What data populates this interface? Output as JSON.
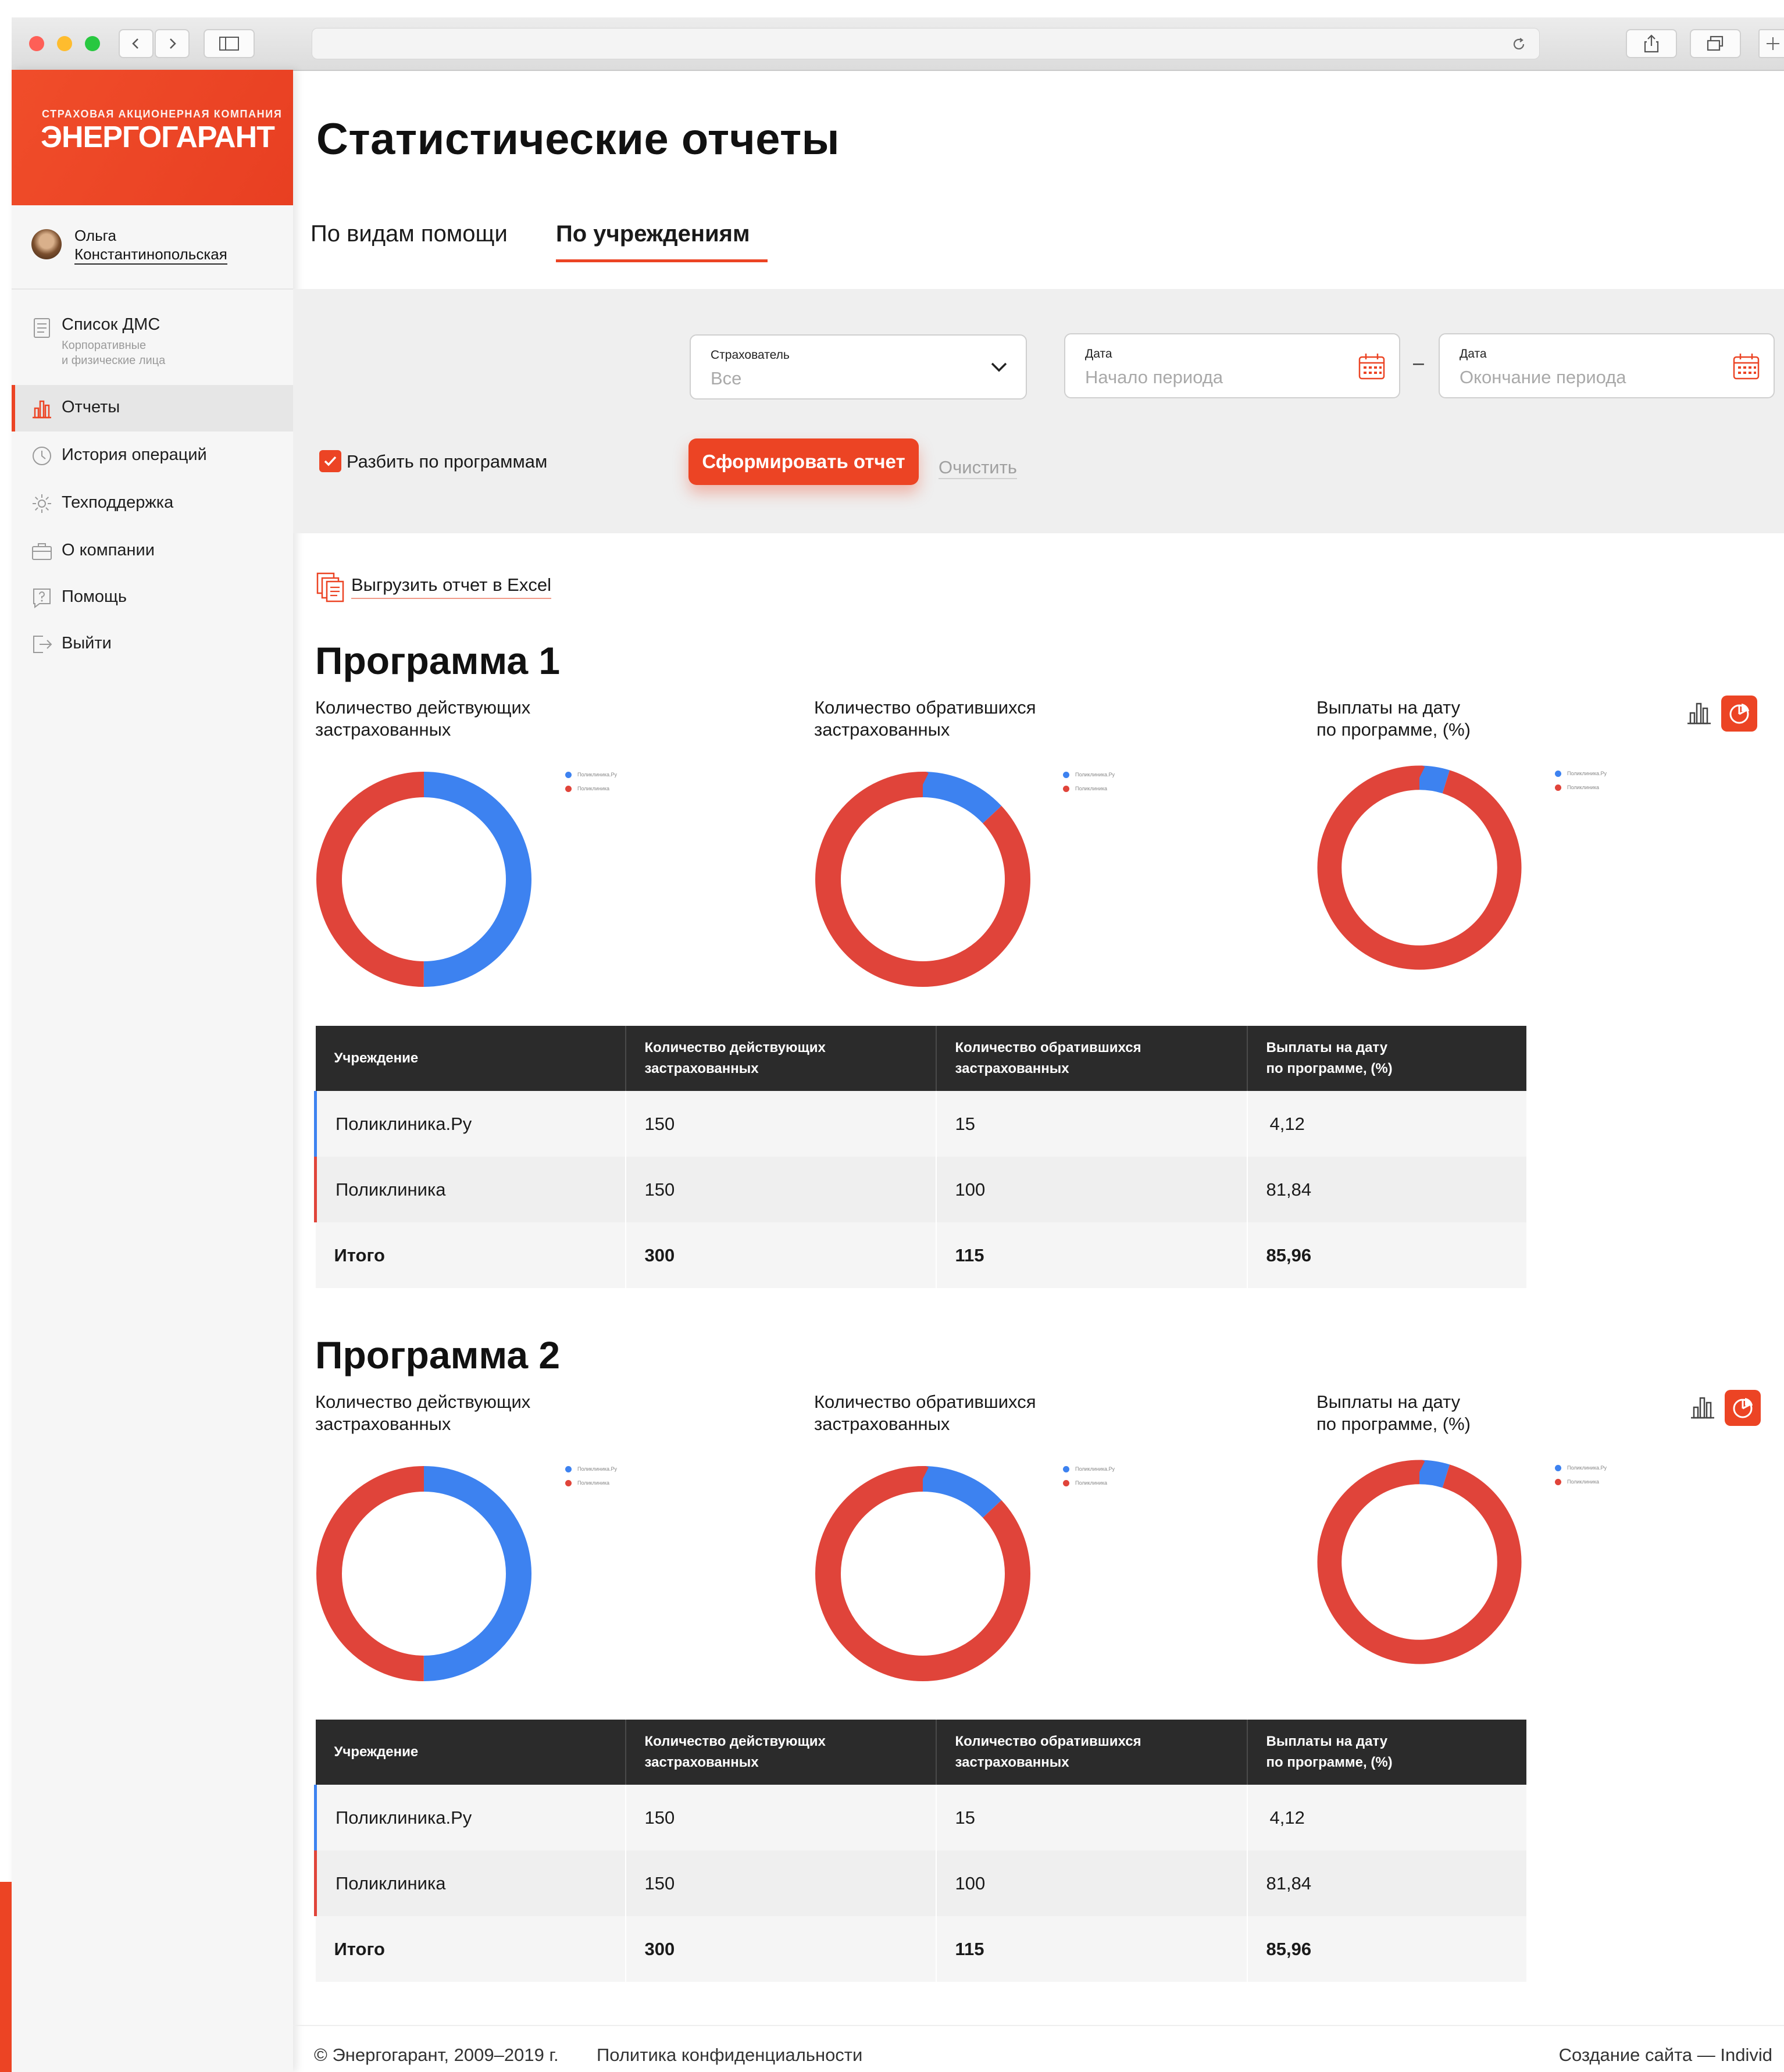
{
  "brand": {
    "company_line": "СТРАХОВАЯ АКЦИОНЕРНАЯ КОМПАНИЯ",
    "name": "ЭНЕРГОГАРАНТ",
    "accent": "#ec4424"
  },
  "user": {
    "first_name": "Ольга",
    "last_name": "Константинопольская"
  },
  "nav": [
    {
      "label": "Список ДМС",
      "sub1": "Корпоративные",
      "sub2": "и физические лица",
      "icon": "list-icon"
    },
    {
      "label": "Отчеты",
      "icon": "bar-chart-icon",
      "active": true
    },
    {
      "label": "История операций",
      "icon": "clock-icon"
    },
    {
      "label": "Техподдержка",
      "icon": "gear-icon"
    },
    {
      "label": "О компании",
      "icon": "briefcase-icon"
    },
    {
      "label": "Помощь",
      "icon": "question-icon"
    },
    {
      "label": "Выйти",
      "icon": "logout-icon"
    }
  ],
  "page": {
    "title": "Статистические отчеты"
  },
  "tabs": [
    {
      "label": "По видам помощи",
      "active": false
    },
    {
      "label": "По учреждениям",
      "active": true
    }
  ],
  "filters": {
    "insurer": {
      "label": "Страхователь",
      "value": "Все"
    },
    "date_start": {
      "label": "Дата",
      "placeholder": "Начало периода"
    },
    "date_end": {
      "label": "Дата",
      "placeholder": "Окончание периода"
    },
    "range_sep": "–",
    "split_checkbox": {
      "label": "Разбить по программам",
      "checked": true
    },
    "submit_label": "Сформировать отчет",
    "clear_label": "Очистить"
  },
  "export_label": "Выгрузить отчет в Excel",
  "legend": {
    "series1": "Поликлиника.Ру",
    "series2": "Поликлиника"
  },
  "colors": {
    "series1": "#3d82f0",
    "series2": "#e0443a",
    "table_header": "#2b2b2b"
  },
  "chart_data": [
    {
      "type": "pie",
      "program": "Программа 1",
      "title": "Количество действующих застрахованных",
      "labels": [
        "Поликлиника.Ру",
        "Поликлиника"
      ],
      "values": [
        150,
        150
      ]
    },
    {
      "type": "pie",
      "program": "Программа 1",
      "title": "Количество обратившихся застрахованных",
      "labels": [
        "Поликлиника.Ру",
        "Поликлиника"
      ],
      "values": [
        15,
        100
      ]
    },
    {
      "type": "pie",
      "program": "Программа 1",
      "title": "Выплаты на дату по программе, (%)",
      "labels": [
        "Поликлиника.Ру",
        "Поликлиника"
      ],
      "values": [
        4.12,
        81.84
      ]
    },
    {
      "type": "pie",
      "program": "Программа 2",
      "title": "Количество действующих застрахованных",
      "labels": [
        "Поликлиника.Ру",
        "Поликлиника"
      ],
      "values": [
        150,
        150
      ]
    },
    {
      "type": "pie",
      "program": "Программа 2",
      "title": "Количество обратившихся застрахованных",
      "labels": [
        "Поликлиника.Ру",
        "Поликлиника"
      ],
      "values": [
        15,
        100
      ]
    },
    {
      "type": "pie",
      "program": "Программа 2",
      "title": "Выплаты на дату по программе, (%)",
      "labels": [
        "Поликлиника.Ру",
        "Поликлиника"
      ],
      "values": [
        4.12,
        81.84
      ]
    }
  ],
  "programs": [
    {
      "title": "Программа 1",
      "captions": [
        [
          "Количество действующих",
          "застрахованных"
        ],
        [
          "Количество обратившихся",
          "застрахованных"
        ],
        [
          "Выплаты на дату",
          "по программе, (%)"
        ]
      ],
      "table": {
        "headers": [
          [
            "Учреждение",
            ""
          ],
          [
            "Количество действующих",
            "застрахованных"
          ],
          [
            "Количество обратившихся",
            "застрахованных"
          ],
          [
            "Выплаты на дату",
            "по программе,  (%)"
          ]
        ],
        "rows": [
          [
            "Поликлиника.Ру",
            "150",
            "15",
            "4,12"
          ],
          [
            "Поликлиника",
            "150",
            "100",
            "81,84"
          ]
        ],
        "total": [
          "Итого",
          "300",
          "115",
          "85,96"
        ]
      }
    },
    {
      "title": "Программа 2",
      "captions": [
        [
          "Количество действующих",
          "застрахованных"
        ],
        [
          "Количество обратившихся",
          "застрахованных"
        ],
        [
          "Выплаты на дату",
          "по программе, (%)"
        ]
      ],
      "table": {
        "headers": [
          [
            "Учреждение",
            ""
          ],
          [
            "Количество действующих",
            "застрахованных"
          ],
          [
            "Количество обратившихся",
            "застрахованных"
          ],
          [
            "Выплаты на дату",
            "по программе,  (%)"
          ]
        ],
        "rows": [
          [
            "Поликлиника.Ру",
            "150",
            "15",
            "4,12"
          ],
          [
            "Поликлиника",
            "150",
            "100",
            "81,84"
          ]
        ],
        "total": [
          "Итого",
          "300",
          "115",
          "85,96"
        ]
      }
    }
  ],
  "footer": {
    "copyright": "© Энергогарант, 2009–2019 г.",
    "privacy": "Политика конфиденциальности",
    "credit": "Создание сайта — Individ"
  }
}
